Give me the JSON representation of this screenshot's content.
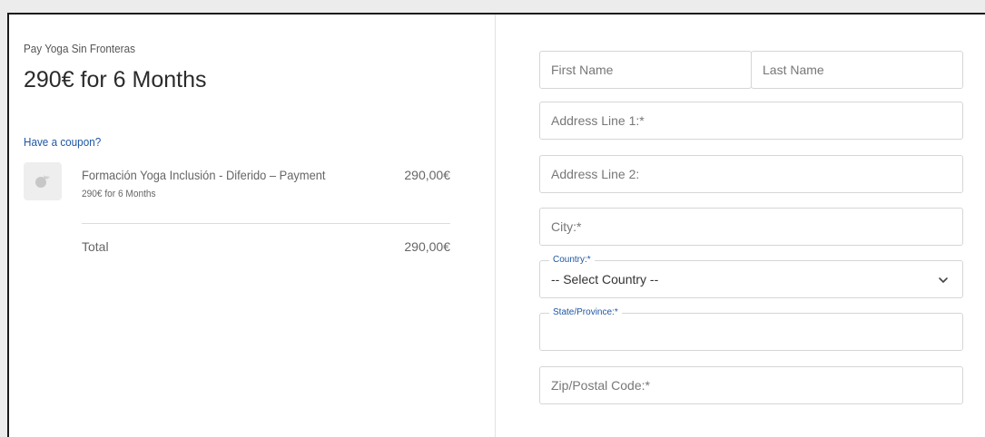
{
  "summary": {
    "store_name": "Pay Yoga Sin Fronteras",
    "plan_title": "290€ for 6 Months",
    "coupon_link": "Have a coupon?",
    "item": {
      "name": "Formación Yoga Inclusión - Diferido – Payment",
      "subtitle": "290€ for 6 Months",
      "price": "290,00€"
    },
    "total_label": "Total",
    "total_value": "290,00€"
  },
  "form": {
    "first_name_placeholder": "First Name",
    "last_name_placeholder": "Last Name",
    "address1_placeholder": "Address Line 1:*",
    "address2_placeholder": "Address Line 2:",
    "city_placeholder": "City:*",
    "country_label": "Country:*",
    "country_value": "-- Select Country --",
    "state_label": "State/Province:*",
    "state_value": "",
    "zip_placeholder": "Zip/Postal Code:*"
  },
  "colors": {
    "link": "#1f56a3",
    "border": "#d6d6d6"
  }
}
